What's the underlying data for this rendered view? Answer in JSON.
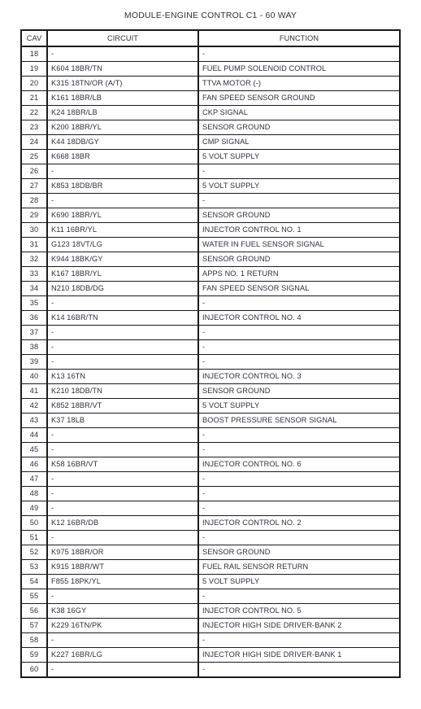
{
  "document": {
    "title": "MODULE-ENGINE CONTROL C1 - 60 WAY"
  },
  "table": {
    "columns": [
      {
        "key": "cav",
        "label": "CAV"
      },
      {
        "key": "circuit",
        "label": "CIRCUIT"
      },
      {
        "key": "function",
        "label": "FUNCTION"
      }
    ],
    "rows": [
      {
        "cav": "18",
        "circuit": "-",
        "function": "-"
      },
      {
        "cav": "19",
        "circuit": "K604 18BR/TN",
        "function": "FUEL PUMP SOLENOID CONTROL"
      },
      {
        "cav": "20",
        "circuit": "K315 18TN/OR (A/T)",
        "function": "TTVA MOTOR (-)"
      },
      {
        "cav": "21",
        "circuit": "K161 18BR/LB",
        "function": "FAN SPEED SENSOR GROUND"
      },
      {
        "cav": "22",
        "circuit": "K24 18BR/LB",
        "function": "CKP SIGNAL"
      },
      {
        "cav": "23",
        "circuit": "K200 18BR/YL",
        "function": "SENSOR GROUND"
      },
      {
        "cav": "24",
        "circuit": "K44 18DB/GY",
        "function": "CMP SIGNAL"
      },
      {
        "cav": "25",
        "circuit": "K668 18BR",
        "function": "5 VOLT SUPPLY"
      },
      {
        "cav": "26",
        "circuit": "-",
        "function": "-"
      },
      {
        "cav": "27",
        "circuit": "K853 18DB/BR",
        "function": "5 VOLT SUPPLY"
      },
      {
        "cav": "28",
        "circuit": "-",
        "function": "-"
      },
      {
        "cav": "29",
        "circuit": "K690 18BR/YL",
        "function": "SENSOR GROUND"
      },
      {
        "cav": "30",
        "circuit": "K11 16BR/YL",
        "function": "INJECTOR CONTROL NO. 1"
      },
      {
        "cav": "31",
        "circuit": "G123 18VT/LG",
        "function": "WATER IN FUEL SENSOR SIGNAL"
      },
      {
        "cav": "32",
        "circuit": "K944 18BK/GY",
        "function": "SENSOR GROUND"
      },
      {
        "cav": "33",
        "circuit": "K167 18BR/YL",
        "function": "APPS NO. 1 RETURN"
      },
      {
        "cav": "34",
        "circuit": "N210 18DB/DG",
        "function": "FAN SPEED SENSOR SIGNAL"
      },
      {
        "cav": "35",
        "circuit": "-",
        "function": "-"
      },
      {
        "cav": "36",
        "circuit": "K14 16BR/TN",
        "function": "INJECTOR CONTROL NO. 4"
      },
      {
        "cav": "37",
        "circuit": "-",
        "function": "-"
      },
      {
        "cav": "38",
        "circuit": "-",
        "function": "-"
      },
      {
        "cav": "39",
        "circuit": "-",
        "function": "-"
      },
      {
        "cav": "40",
        "circuit": "K13 16TN",
        "function": "INJECTOR CONTROL NO. 3"
      },
      {
        "cav": "41",
        "circuit": "K210 18DB/TN",
        "function": "SENSOR GROUND"
      },
      {
        "cav": "42",
        "circuit": "K852 18BR/VT",
        "function": "5 VOLT SUPPLY"
      },
      {
        "cav": "43",
        "circuit": "K37 18LB",
        "function": "BOOST PRESSURE SENSOR SIGNAL"
      },
      {
        "cav": "44",
        "circuit": "-",
        "function": "-"
      },
      {
        "cav": "45",
        "circuit": "-",
        "function": "-"
      },
      {
        "cav": "46",
        "circuit": "K58 16BR/VT",
        "function": "INJECTOR CONTROL NO. 6"
      },
      {
        "cav": "47",
        "circuit": "-",
        "function": "-"
      },
      {
        "cav": "48",
        "circuit": "-",
        "function": "-"
      },
      {
        "cav": "49",
        "circuit": "-",
        "function": "-"
      },
      {
        "cav": "50",
        "circuit": "K12 16BR/DB",
        "function": "INJECTOR CONTROL NO. 2"
      },
      {
        "cav": "51",
        "circuit": "-",
        "function": "-"
      },
      {
        "cav": "52",
        "circuit": "K975 18BR/OR",
        "function": "SENSOR GROUND"
      },
      {
        "cav": "53",
        "circuit": "K915 18BR/WT",
        "function": "FUEL RAIL SENSOR RETURN"
      },
      {
        "cav": "54",
        "circuit": "F855 18PK/YL",
        "function": "5 VOLT SUPPLY"
      },
      {
        "cav": "55",
        "circuit": "-",
        "function": "-"
      },
      {
        "cav": "56",
        "circuit": "K38 16GY",
        "function": "INJECTOR CONTROL NO. 5"
      },
      {
        "cav": "57",
        "circuit": "K229 16TN/PK",
        "function": "INJECTOR HIGH SIDE DRIVER-BANK 2"
      },
      {
        "cav": "58",
        "circuit": "-",
        "function": "-"
      },
      {
        "cav": "59",
        "circuit": "K227 16BR/LG",
        "function": "INJECTOR HIGH SIDE DRIVER-BANK 1"
      },
      {
        "cav": "60",
        "circuit": "-",
        "function": "-"
      }
    ]
  },
  "colors": {
    "border": "#1b1b1b",
    "text": "#2d3040",
    "background": "#ffffff"
  }
}
